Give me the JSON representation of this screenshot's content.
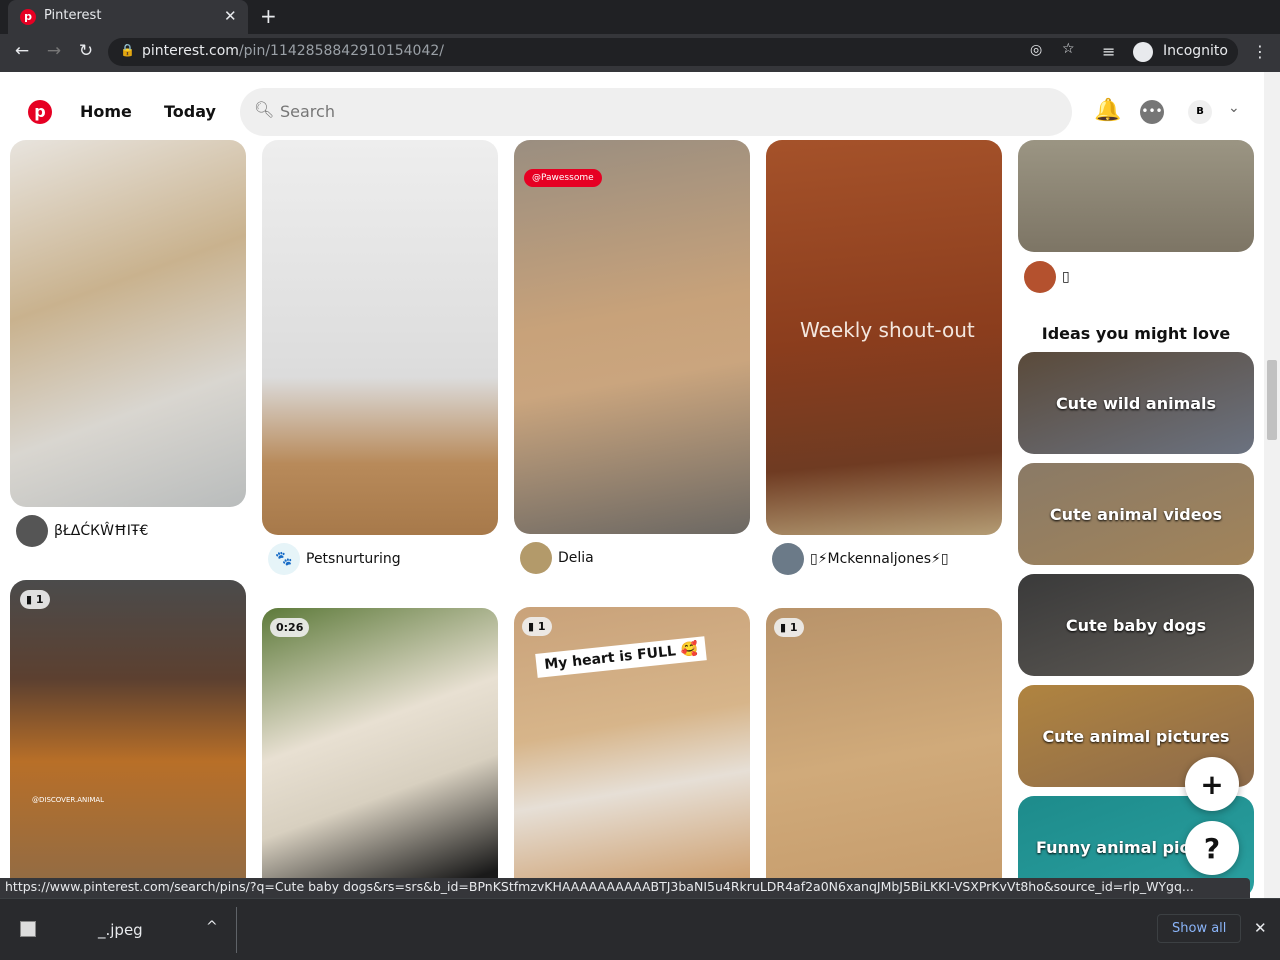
{
  "browser": {
    "tab_title": "Pinterest",
    "url_host": "pinterest.com",
    "url_path": "/pin/1142858842910154042/",
    "profile_label": "Incognito"
  },
  "header": {
    "nav": [
      "Home",
      "Today"
    ],
    "search_placeholder": "Search",
    "avatar_initial": "B"
  },
  "pins": [
    {
      "author": "βŁΔĆКŴĦIŦ€"
    },
    {
      "author": "Petsnurturing"
    },
    {
      "author": "Delia",
      "tag": "@Pawessome"
    },
    {
      "author": "▯⚡Mckennaljones⚡▯",
      "overlay": "Weekly shout-out"
    },
    {
      "author": "▯"
    }
  ],
  "lower_pins": [
    {
      "badge": "1",
      "watermark": "@DISCOVER.ANIMAL"
    },
    {
      "badge": "0:26"
    },
    {
      "badge": "1",
      "caption": "My heart is FULL 🥰"
    },
    {
      "badge": "1"
    }
  ],
  "ideas": {
    "heading": "Ideas you might love",
    "items": [
      "Cute wild animals",
      "Cute animal videos",
      "Cute baby dogs",
      "Cute animal pictures",
      "Funny animal pic"
    ]
  },
  "fab": {
    "plus": "+",
    "help": "?"
  },
  "status_url": "https://www.pinterest.com/search/pins/?q=Cute baby dogs&rs=srs&b_id=BPnKStfmzvKHAAAAAAAAAABTJ3baNI5u4RkruLDR4af2a0N6xanqJMbJ5BiLKKI-VSXPrKvVt8ho&source_id=rlp_WYgq...",
  "downloads": {
    "file": "_.jpeg",
    "show_all": "Show all"
  }
}
